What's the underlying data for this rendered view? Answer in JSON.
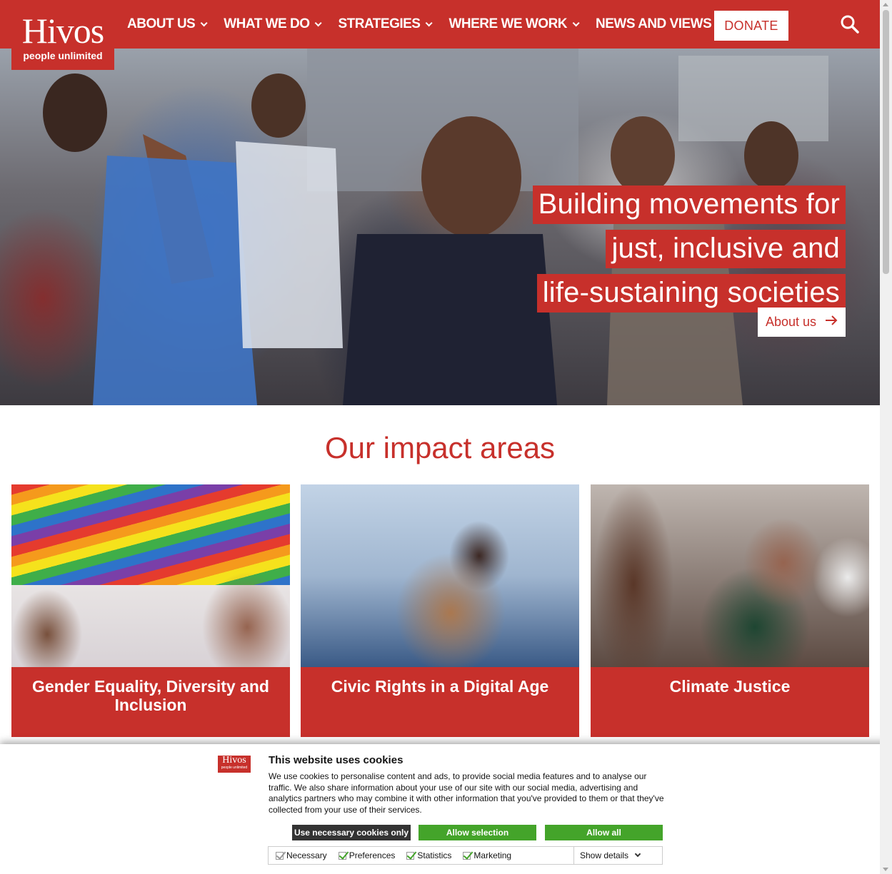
{
  "brand": {
    "name": "Hivos",
    "tagline": "people unlimited",
    "color": "#c7302b"
  },
  "nav": {
    "items": [
      {
        "label": "ABOUT US"
      },
      {
        "label": "WHAT WE DO"
      },
      {
        "label": "STRATEGIES"
      },
      {
        "label": "WHERE WE WORK"
      },
      {
        "label": "NEWS AND VIEWS"
      }
    ],
    "donate_label": "DONATE",
    "search_icon": "search-icon"
  },
  "hero": {
    "title_lines": [
      "Building movements for",
      "just, inclusive and",
      "life-sustaining societies"
    ],
    "button_label": "About us",
    "button_icon": "arrow-right-icon"
  },
  "impact": {
    "title": "Our impact areas",
    "cards": [
      {
        "label": "Gender Equality, Diversity and Inclusion"
      },
      {
        "label": "Civic Rights in a Digital Age"
      },
      {
        "label": "Climate Justice"
      }
    ]
  },
  "cookie": {
    "logo_word": "Hivos",
    "logo_tag": "people unlimited",
    "title": "This website uses cookies",
    "text": "We use cookies to personalise content and ads, to provide social media features and to analyse our traffic. We also share information about your use of our site with our social media, advertising and analytics partners who may combine it with other information that you've provided to them or that they've collected from your use of their services.",
    "buttons": {
      "necessary": "Use necessary cookies only",
      "selection": "Allow selection",
      "all": "Allow all"
    },
    "checkboxes": [
      {
        "label": "Necessary",
        "checked": true,
        "disabled": true
      },
      {
        "label": "Preferences",
        "checked": true
      },
      {
        "label": "Statistics",
        "checked": true
      },
      {
        "label": "Marketing",
        "checked": true
      }
    ],
    "show_details": "Show details",
    "colors": {
      "accept": "#44a42a",
      "necessary": "#333333"
    }
  }
}
